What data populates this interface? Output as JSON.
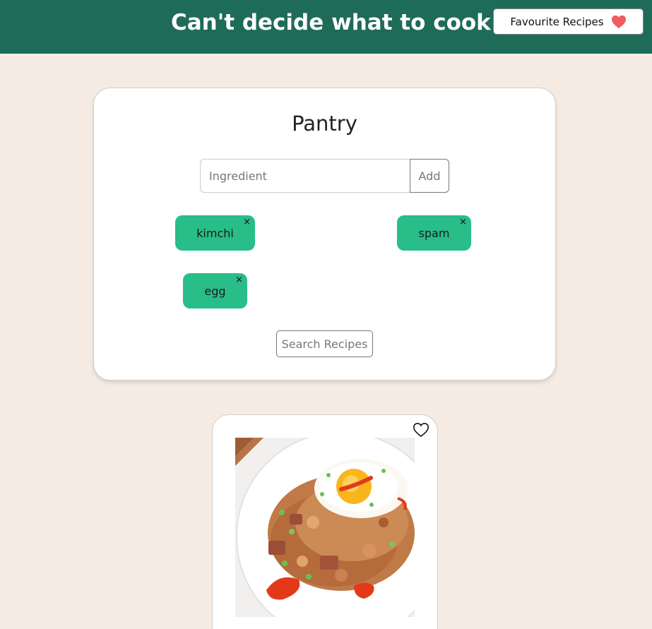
{
  "header": {
    "title": "Can't decide what to cook ?",
    "favourites_label": "Favourite Recipes",
    "favourites_icon": "heart-icon",
    "heart_color": "#f25c5c",
    "bg_color": "#1e6b58"
  },
  "pantry": {
    "title": "Pantry",
    "input_placeholder": "Ingredient",
    "input_value": "",
    "add_label": "Add",
    "ingredients": [
      {
        "label": "kimchi",
        "remove": "×"
      },
      {
        "label": "spam",
        "remove": "×"
      },
      {
        "label": "egg",
        "remove": "×"
      }
    ],
    "chip_color": "#28bd89",
    "search_label": "Search Recipes"
  },
  "results": {
    "recipes": [
      {
        "image": "fried-rice-photo",
        "favourite_icon": "heart-outline-icon"
      }
    ]
  }
}
